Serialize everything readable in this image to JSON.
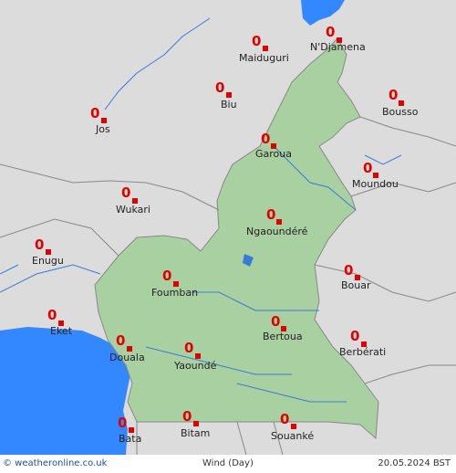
{
  "map": {
    "colors": {
      "land": "#dcdcdc",
      "cameroon": "#a9d0a1",
      "water": "#3388ff",
      "rivers": "#3a7bd5",
      "borders": "#888888",
      "value": "#e10000"
    },
    "cities": [
      {
        "name": "N'Djamena",
        "value": "0"
      },
      {
        "name": "Maiduguri",
        "value": "0"
      },
      {
        "name": "Biu",
        "value": "0"
      },
      {
        "name": "Bousso",
        "value": "0"
      },
      {
        "name": "Jos",
        "value": "0"
      },
      {
        "name": "Garoua",
        "value": "0"
      },
      {
        "name": "Moundou",
        "value": "0"
      },
      {
        "name": "Wukari",
        "value": "0"
      },
      {
        "name": "Ngaoundéré",
        "value": "0"
      },
      {
        "name": "Enugu",
        "value": "0"
      },
      {
        "name": "Bouar",
        "value": "0"
      },
      {
        "name": "Foumban",
        "value": "0"
      },
      {
        "name": "Eket",
        "value": "0"
      },
      {
        "name": "Bertoua",
        "value": "0"
      },
      {
        "name": "Berbérati",
        "value": "0"
      },
      {
        "name": "Douala",
        "value": "0"
      },
      {
        "name": "Yaoundé",
        "value": "0"
      },
      {
        "name": "Bata",
        "value": "0"
      },
      {
        "name": "Bitam",
        "value": "0"
      },
      {
        "name": "Souanké",
        "value": "0"
      }
    ]
  },
  "footer": {
    "credit": "© weatheronline.co.uk",
    "title": "Wind (Day)",
    "date": "20.05.2024 BST"
  }
}
